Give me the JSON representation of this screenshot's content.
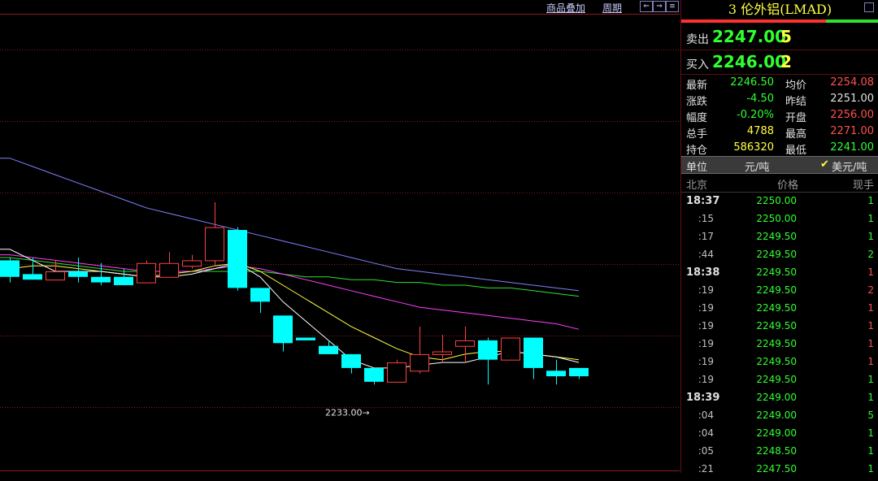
{
  "toolbar": {
    "overlay_label": "商品叠加",
    "period_label": "周期",
    "nav": [
      "⇐",
      "⇒",
      "≡"
    ]
  },
  "chart_data": {
    "type": "candlestick",
    "ylim": [
      2222,
      2305
    ],
    "low_marker": {
      "value": 2233.0,
      "label": "2233.00→"
    },
    "colors": {
      "up": "#ff4040",
      "down": "#00ffff",
      "ma1": "#ffffff",
      "ma2": "#ffff40",
      "ma3": "#ff40ff",
      "ma4": "#30e030",
      "ma5": "#8080ff"
    },
    "candles": [
      {
        "o": 2260.5,
        "h": 2261.0,
        "l": 2256.5,
        "c": 2257.5
      },
      {
        "o": 2258.0,
        "h": 2261.0,
        "l": 2257.0,
        "c": 2257.0
      },
      {
        "o": 2257.0,
        "h": 2260.5,
        "l": 2257.0,
        "c": 2258.5
      },
      {
        "o": 2258.5,
        "h": 2261.0,
        "l": 2256.5,
        "c": 2257.5
      },
      {
        "o": 2257.5,
        "h": 2260.0,
        "l": 2256.0,
        "c": 2256.5
      },
      {
        "o": 2257.5,
        "h": 2259.0,
        "l": 2256.0,
        "c": 2256.0
      },
      {
        "o": 2256.5,
        "h": 2260.5,
        "l": 2256.5,
        "c": 2260.0
      },
      {
        "o": 2257.5,
        "h": 2262.0,
        "l": 2257.5,
        "c": 2260.0
      },
      {
        "o": 2259.5,
        "h": 2261.5,
        "l": 2259.0,
        "c": 2260.5
      },
      {
        "o": 2260.5,
        "h": 2271.0,
        "l": 2259.5,
        "c": 2266.5
      },
      {
        "o": 2266.0,
        "h": 2266.5,
        "l": 2255.0,
        "c": 2255.5
      },
      {
        "o": 2255.5,
        "h": 2255.5,
        "l": 2251.0,
        "c": 2253.0
      },
      {
        "o": 2250.5,
        "h": 2250.5,
        "l": 2244.0,
        "c": 2245.5
      },
      {
        "o": 2246.5,
        "h": 2246.5,
        "l": 2246.0,
        "c": 2246.0
      },
      {
        "o": 2245.0,
        "h": 2246.0,
        "l": 2243.5,
        "c": 2243.5
      },
      {
        "o": 2243.5,
        "h": 2243.5,
        "l": 2240.0,
        "c": 2241.0
      },
      {
        "o": 2241.0,
        "h": 2241.0,
        "l": 2238.0,
        "c": 2238.5
      },
      {
        "o": 2238.5,
        "h": 2242.5,
        "l": 2238.5,
        "c": 2242.0
      },
      {
        "o": 2240.5,
        "h": 2248.5,
        "l": 2240.0,
        "c": 2243.5
      },
      {
        "o": 2243.5,
        "h": 2247.0,
        "l": 2242.0,
        "c": 2244.0
      },
      {
        "o": 2245.0,
        "h": 2248.5,
        "l": 2242.0,
        "c": 2246.0
      },
      {
        "o": 2246.0,
        "h": 2246.5,
        "l": 2238.0,
        "c": 2242.5
      },
      {
        "o": 2242.5,
        "h": 2246.5,
        "l": 2242.5,
        "c": 2246.5
      },
      {
        "o": 2246.5,
        "h": 2246.5,
        "l": 2239.0,
        "c": 2241.0
      },
      {
        "o": 2240.5,
        "h": 2242.5,
        "l": 2238.0,
        "c": 2239.5
      },
      {
        "o": 2241.0,
        "h": 2241.0,
        "l": 2239.0,
        "c": 2239.5
      }
    ],
    "ma_lines": [
      {
        "values": [
          2262.5,
          2260.5,
          2258.5,
          2258.5,
          2258.5,
          2258.0,
          2257.5,
          2257.5,
          2258.0,
          2259.0,
          2260.0,
          2257.5,
          2253.0,
          2249.5,
          2246.0,
          2242.5,
          2241.0,
          2241.0,
          2241.5,
          2242.0,
          2242.0,
          2243.0,
          2244.0,
          2243.5,
          2243.0,
          2242.0
        ]
      },
      {
        "values": [
          2259.0,
          2259.5,
          2259.5,
          2259.0,
          2258.5,
          2258.0,
          2257.5,
          2258.0,
          2258.5,
          2259.5,
          2260.0,
          2258.5,
          2256.0,
          2253.5,
          2251.0,
          2248.5,
          2246.5,
          2244.5,
          2243.0,
          2242.5,
          2243.5,
          2244.0,
          2244.0,
          2243.5,
          2243.0,
          2242.5
        ]
      },
      {
        "values": [
          2261.5,
          2261.0,
          2260.5,
          2260.0,
          2259.5,
          2259.0,
          2258.5,
          2258.5,
          2258.5,
          2259.0,
          2259.5,
          2259.0,
          2258.0,
          2257.0,
          2256.0,
          2255.0,
          2254.0,
          2253.0,
          2252.0,
          2251.5,
          2251.0,
          2250.5,
          2250.0,
          2249.5,
          2249.0,
          2248.0
        ]
      },
      {
        "values": [
          2261.0,
          2260.5,
          2260.0,
          2259.5,
          2259.0,
          2258.5,
          2258.5,
          2258.5,
          2258.5,
          2258.5,
          2258.5,
          2258.5,
          2258.0,
          2257.5,
          2257.5,
          2257.0,
          2257.0,
          2256.5,
          2256.5,
          2256.0,
          2256.0,
          2255.5,
          2255.5,
          2255.0,
          2254.5,
          2254.0
        ]
      },
      {
        "values": [
          2279.0,
          2277.5,
          2276.0,
          2274.5,
          2273.0,
          2271.5,
          2270.0,
          2269.0,
          2268.0,
          2267.0,
          2266.0,
          2265.0,
          2264.0,
          2263.0,
          2262.0,
          2261.0,
          2260.0,
          2259.0,
          2258.5,
          2258.0,
          2257.5,
          2257.0,
          2256.5,
          2256.0,
          2255.5,
          2255.0
        ]
      }
    ]
  },
  "panel": {
    "title": "3 伦外铝(LMAD)",
    "sell": {
      "label": "卖出",
      "price": "2247.00",
      "vol": "5"
    },
    "buy": {
      "label": "买入",
      "price": "2246.00",
      "vol": "2"
    },
    "stats": [
      {
        "l1": "最新",
        "v1": "2246.50",
        "c1": "#30ff30",
        "l2": "均价",
        "v2": "2254.08",
        "c2": "#ff5050"
      },
      {
        "l1": "涨跌",
        "v1": "-4.50",
        "c1": "#30ff30",
        "l2": "昨结",
        "v2": "2251.00",
        "c2": "#e0e0e0"
      },
      {
        "l1": "幅度",
        "v1": "-0.20%",
        "c1": "#30ff30",
        "l2": "开盘",
        "v2": "2256.00",
        "c2": "#ff5050"
      },
      {
        "l1": "总手",
        "v1": "4788",
        "c1": "#ffff40",
        "l2": "最高",
        "v2": "2271.00",
        "c2": "#ff5050"
      },
      {
        "l1": "持仓",
        "v1": "586320",
        "c1": "#ffff40",
        "l2": "最低",
        "v2": "2241.00",
        "c2": "#30ff30"
      }
    ],
    "unit": {
      "label": "单位",
      "cny": "元/吨",
      "usd": "美元/吨"
    },
    "ticks_header": {
      "loc": "北京",
      "price": "价格",
      "vol": "现手"
    },
    "ticks": [
      {
        "t": "18:37",
        "full": true,
        "p": "2250.00",
        "v": "1",
        "vc": "#30ff30"
      },
      {
        "t": ":15",
        "full": false,
        "p": "2250.00",
        "v": "1",
        "vc": "#30ff30"
      },
      {
        "t": ":17",
        "full": false,
        "p": "2249.50",
        "v": "1",
        "vc": "#30ff30"
      },
      {
        "t": ":44",
        "full": false,
        "p": "2249.50",
        "v": "2",
        "vc": "#30ff30"
      },
      {
        "t": "18:38",
        "full": true,
        "p": "2249.50",
        "v": "1",
        "vc": "#ff5050"
      },
      {
        "t": ":19",
        "full": false,
        "p": "2249.50",
        "v": "2",
        "vc": "#ff5050"
      },
      {
        "t": ":19",
        "full": false,
        "p": "2249.50",
        "v": "1",
        "vc": "#ff5050"
      },
      {
        "t": ":19",
        "full": false,
        "p": "2249.50",
        "v": "1",
        "vc": "#ff5050"
      },
      {
        "t": ":19",
        "full": false,
        "p": "2249.50",
        "v": "1",
        "vc": "#ff5050"
      },
      {
        "t": ":19",
        "full": false,
        "p": "2249.50",
        "v": "1",
        "vc": "#ff5050"
      },
      {
        "t": ":19",
        "full": false,
        "p": "2249.50",
        "v": "1",
        "vc": "#30ff30"
      },
      {
        "t": "18:39",
        "full": true,
        "p": "2249.00",
        "v": "1",
        "vc": "#30ff30"
      },
      {
        "t": ":04",
        "full": false,
        "p": "2249.00",
        "v": "5",
        "vc": "#30ff30"
      },
      {
        "t": ":04",
        "full": false,
        "p": "2249.00",
        "v": "1",
        "vc": "#30ff30"
      },
      {
        "t": ":05",
        "full": false,
        "p": "2248.50",
        "v": "1",
        "vc": "#30ff30"
      },
      {
        "t": ":21",
        "full": false,
        "p": "2247.50",
        "v": "1",
        "vc": "#30ff30"
      }
    ]
  }
}
